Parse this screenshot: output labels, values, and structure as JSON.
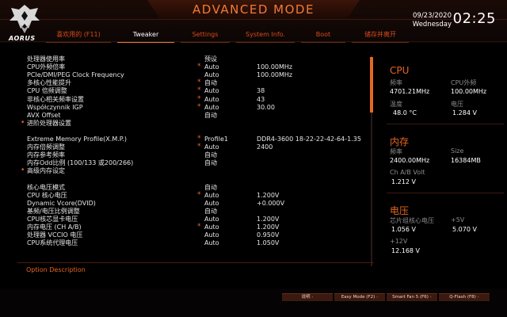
{
  "header": {
    "mode_title": "ADVANCED MODE",
    "logo_text": "AORUS",
    "date": "09/23/2020",
    "weekday": "Wednesday",
    "time": "02:25",
    "accent": "#e8661c"
  },
  "tabs": [
    {
      "label": "喜欢用的 (F11)",
      "active": false
    },
    {
      "label": "Tweaker",
      "active": true
    },
    {
      "label": "Settings",
      "active": false
    },
    {
      "label": "System Info.",
      "active": false
    },
    {
      "label": "Boot",
      "active": false
    },
    {
      "label": "储存并离开",
      "active": false
    }
  ],
  "rows": [
    {
      "label": "处理器使用率",
      "value": "预设",
      "value2": "",
      "star": false,
      "submenu": false
    },
    {
      "label": "CPU外频倍率",
      "value": "Auto",
      "value2": "100.00MHz",
      "star": true,
      "submenu": false
    },
    {
      "label": "PCIe/DMI/PEG Clock Frequency",
      "value": "Auto",
      "value2": "100.00MHz",
      "star": false,
      "submenu": false
    },
    {
      "label": "多核心性能提升",
      "value": "自动",
      "value2": "",
      "star": true,
      "submenu": false
    },
    {
      "label": "CPU 倍频调整",
      "value": "Auto",
      "value2": "38",
      "star": true,
      "submenu": false
    },
    {
      "label": "非核心相关频率设置",
      "value": "Auto",
      "value2": "43",
      "star": true,
      "submenu": false
    },
    {
      "label": "Współczynnik IGP",
      "value": "Auto",
      "value2": "30.00",
      "star": true,
      "submenu": false
    },
    {
      "label": "AVX Offset",
      "value": "自动",
      "value2": "",
      "star": false,
      "submenu": false
    },
    {
      "label": "进阶处理器设置",
      "value": "",
      "value2": "",
      "star": false,
      "submenu": true
    },
    {
      "label": "",
      "value": "",
      "value2": "",
      "star": false,
      "submenu": false
    },
    {
      "label": "Extreme Memory Profile(X.M.P.)",
      "value": "Profile1",
      "value2": "DDR4-3600 18-22-22-42-64-1.35",
      "star": true,
      "submenu": false
    },
    {
      "label": "内存倍频调整",
      "value": "Auto",
      "value2": "2400",
      "star": true,
      "submenu": false
    },
    {
      "label": "内存参考频率",
      "value": "自动",
      "value2": "",
      "star": false,
      "submenu": false
    },
    {
      "label": "内存Odd比例 (100/133 或200/266)",
      "value": "自动",
      "value2": "",
      "star": false,
      "submenu": false
    },
    {
      "label": "高级内存设定",
      "value": "",
      "value2": "",
      "star": false,
      "submenu": true
    },
    {
      "label": "",
      "value": "",
      "value2": "",
      "star": false,
      "submenu": false
    },
    {
      "label": "核心电压模式",
      "value": "自动",
      "value2": "",
      "star": false,
      "submenu": false
    },
    {
      "label": "CPU 核心电压",
      "value": "Auto",
      "value2": "1.200V",
      "star": true,
      "submenu": false
    },
    {
      "label": "Dynamic Vcore(DVID)",
      "value": "Auto",
      "value2": "+0.000V",
      "star": false,
      "submenu": false
    },
    {
      "label": "基频/电压比例调整",
      "value": "自动",
      "value2": "",
      "star": false,
      "submenu": false
    },
    {
      "label": "CPU核芯显卡电压",
      "value": "Auto",
      "value2": "1.200V",
      "star": false,
      "submenu": false
    },
    {
      "label": "内存电压 (CH A/B)",
      "value": "Auto",
      "value2": "1.200V",
      "star": true,
      "submenu": false
    },
    {
      "label": "处理器 VCCIO 电压",
      "value": "Auto",
      "value2": "0.950V",
      "star": false,
      "submenu": false
    },
    {
      "label": "CPU系统代理电压",
      "value": "Auto",
      "value2": "1.050V",
      "star": false,
      "submenu": false
    }
  ],
  "side": {
    "cpu": {
      "title": "CPU",
      "freq_label": "频率",
      "freq": "4701.21MHz",
      "bclk_label": "CPU外频",
      "bclk": "100.00MHz",
      "temp_label": "温度",
      "temp": "48.0 °C",
      "volt_label": "电压",
      "volt": "1.284 V"
    },
    "mem": {
      "title": "内存",
      "freq_label": "频率",
      "freq": "2400.00MHz",
      "size_label": "Size",
      "size": "16384MB",
      "volt_label": "Ch A/B Volt",
      "volt": "1.212 V"
    },
    "voltage": {
      "title": "电压",
      "pch_label": "芯片组核心电压",
      "pch": "1.056 V",
      "p5_label": "+5V",
      "p5": "5.070 V",
      "p12_label": "+12V",
      "p12": "12.168 V"
    }
  },
  "option_description": "Option Description",
  "footer_buttons": [
    {
      "label": "说明"
    },
    {
      "label": "Easy Mode (F2)"
    },
    {
      "label": "Smart Fan 5 (F6)"
    },
    {
      "label": "Q-Flash (F8)"
    }
  ]
}
